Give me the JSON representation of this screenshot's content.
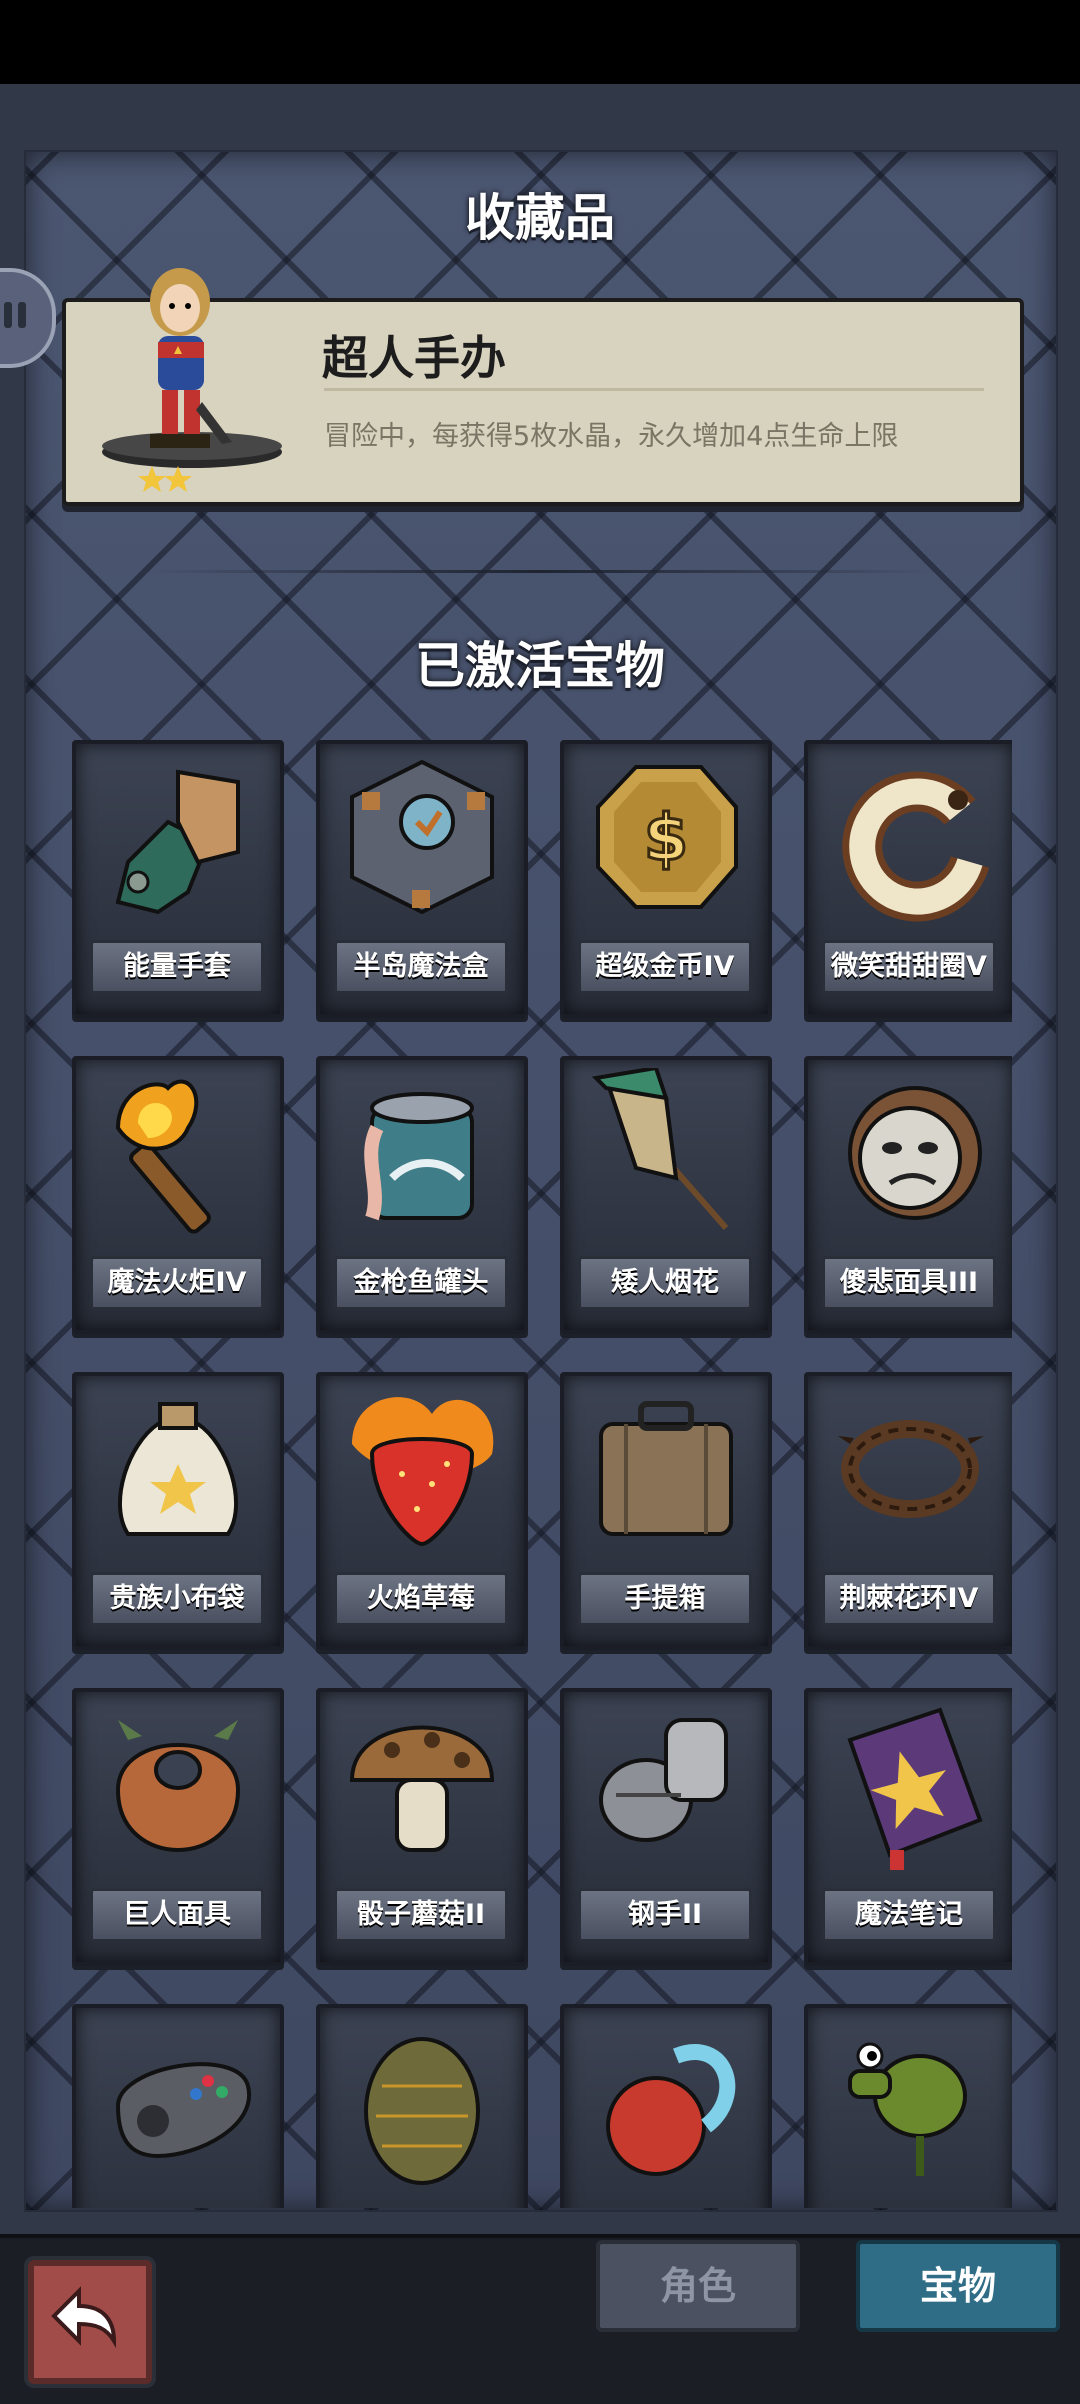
{
  "header": {
    "title": "收藏品"
  },
  "collectible": {
    "name": "超人手办",
    "description": "冒险中，每获得5枚水晶，永久增加4点生命上限",
    "stars": 2
  },
  "section": {
    "title": "已激活宝物"
  },
  "items": [
    {
      "label": "能量手套",
      "icon": "gauntlet-icon"
    },
    {
      "label": "半岛魔法盒",
      "icon": "magic-cube-icon"
    },
    {
      "label": "超级金币IV",
      "icon": "gold-coin-icon"
    },
    {
      "label": "微笑甜甜圈V",
      "icon": "donut-icon"
    },
    {
      "label": "魔法火炬IV",
      "icon": "torch-icon"
    },
    {
      "label": "金枪鱼罐头",
      "icon": "tuna-can-icon"
    },
    {
      "label": "矮人烟花",
      "icon": "firework-rocket-icon"
    },
    {
      "label": "傻悲面具III",
      "icon": "mask-icon"
    },
    {
      "label": "贵族小布袋",
      "icon": "cloth-bag-icon"
    },
    {
      "label": "火焰草莓",
      "icon": "strawberry-icon"
    },
    {
      "label": "手提箱",
      "icon": "suitcase-icon"
    },
    {
      "label": "荆棘花环IV",
      "icon": "thorn-wreath-icon"
    },
    {
      "label": "巨人面具",
      "icon": "giant-mask-icon"
    },
    {
      "label": "骰子蘑菇II",
      "icon": "mushroom-icon"
    },
    {
      "label": "钢手II",
      "icon": "steel-fist-icon"
    },
    {
      "label": "魔法笔记",
      "icon": "spellbook-icon"
    },
    {
      "label": "",
      "icon": "gamepad-icon"
    },
    {
      "label": "",
      "icon": "dragon-egg-icon"
    },
    {
      "label": "",
      "icon": "water-orb-icon"
    },
    {
      "label": "",
      "icon": "peashooter-icon"
    }
  ],
  "bottom_nav": {
    "back_icon": "back-arrow-icon",
    "tab_role": "角色",
    "tab_treasure": "宝物",
    "active": "宝物"
  }
}
